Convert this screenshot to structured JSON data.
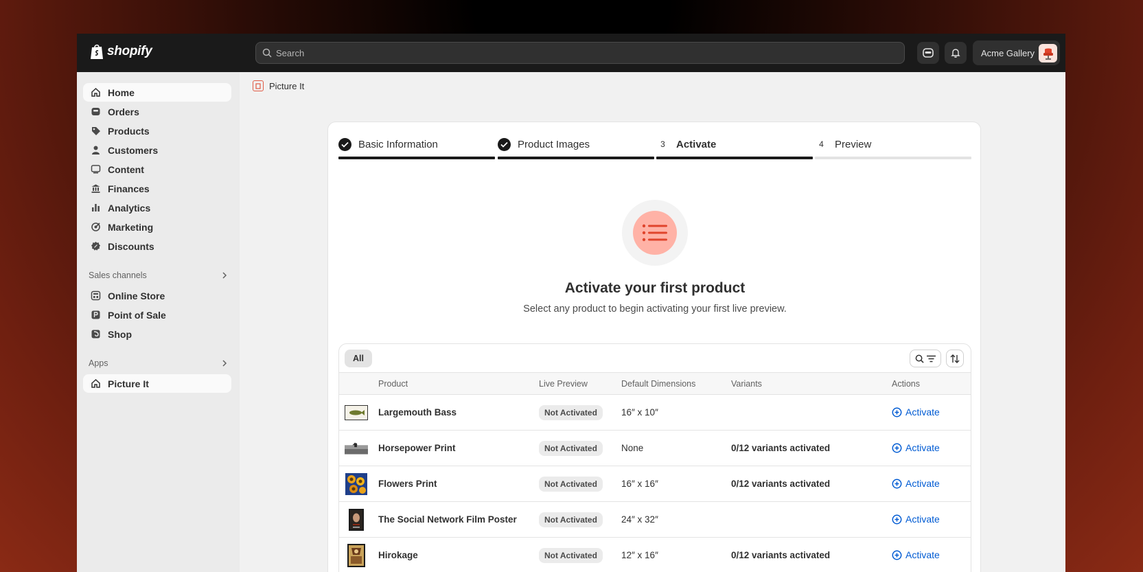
{
  "topbar": {
    "brand": "shopify",
    "search_placeholder": "Search",
    "store_name": "Acme Gallery"
  },
  "sidebar": {
    "items": [
      {
        "label": "Home",
        "icon": "home-icon",
        "active": true
      },
      {
        "label": "Orders",
        "icon": "inbox-icon"
      },
      {
        "label": "Products",
        "icon": "tag-icon"
      },
      {
        "label": "Customers",
        "icon": "person-icon"
      },
      {
        "label": "Content",
        "icon": "image-icon"
      },
      {
        "label": "Finances",
        "icon": "bank-icon"
      },
      {
        "label": "Analytics",
        "icon": "bar-chart-icon"
      },
      {
        "label": "Marketing",
        "icon": "target-icon"
      },
      {
        "label": "Discounts",
        "icon": "discount-icon"
      }
    ],
    "sales_channels_title": "Sales channels",
    "sales_channels": [
      {
        "label": "Online Store",
        "icon": "store-icon"
      },
      {
        "label": "Point of Sale",
        "icon": "pos-icon"
      },
      {
        "label": "Shop",
        "icon": "shop-icon"
      }
    ],
    "apps_title": "Apps",
    "apps": [
      {
        "label": "Picture It",
        "icon": "home-icon",
        "active": true
      }
    ]
  },
  "breadcrumb": {
    "app_name": "Picture It"
  },
  "steps": [
    {
      "label": "Basic Information",
      "state": "done"
    },
    {
      "label": "Product Images",
      "state": "done"
    },
    {
      "number": "3",
      "label": "Activate",
      "state": "current"
    },
    {
      "number": "4",
      "label": "Preview",
      "state": "upcoming"
    }
  ],
  "hero": {
    "title": "Activate your first product",
    "subtitle": "Select any product to begin activating your first live preview."
  },
  "table": {
    "tab_all": "All",
    "columns": [
      "Product",
      "Live Preview",
      "Default Dimensions",
      "Variants",
      "Actions"
    ],
    "rows": [
      {
        "product": "Largemouth Bass",
        "status": "Not Activated",
        "dimensions": "16″ x 10″",
        "variants": "",
        "action": "Activate"
      },
      {
        "product": "Horsepower Print",
        "status": "Not Activated",
        "dimensions": "None",
        "variants": "0/12 variants activated",
        "action": "Activate"
      },
      {
        "product": "Flowers Print",
        "status": "Not Activated",
        "dimensions": "16″ x 16″",
        "variants": "0/12 variants activated",
        "action": "Activate"
      },
      {
        "product": "The Social Network Film Poster",
        "status": "Not Activated",
        "dimensions": "24″ x 32″",
        "variants": "",
        "action": "Activate"
      },
      {
        "product": "Hirokage",
        "status": "Not Activated",
        "dimensions": "12″ x 16″",
        "variants": "0/12 variants activated",
        "action": "Activate"
      }
    ]
  },
  "colors": {
    "topbar": "#1a1a1a",
    "accent_link": "#005bd3",
    "hero_icon_bg": "#ffb2a6",
    "hero_icon_fg": "#e0442c"
  }
}
